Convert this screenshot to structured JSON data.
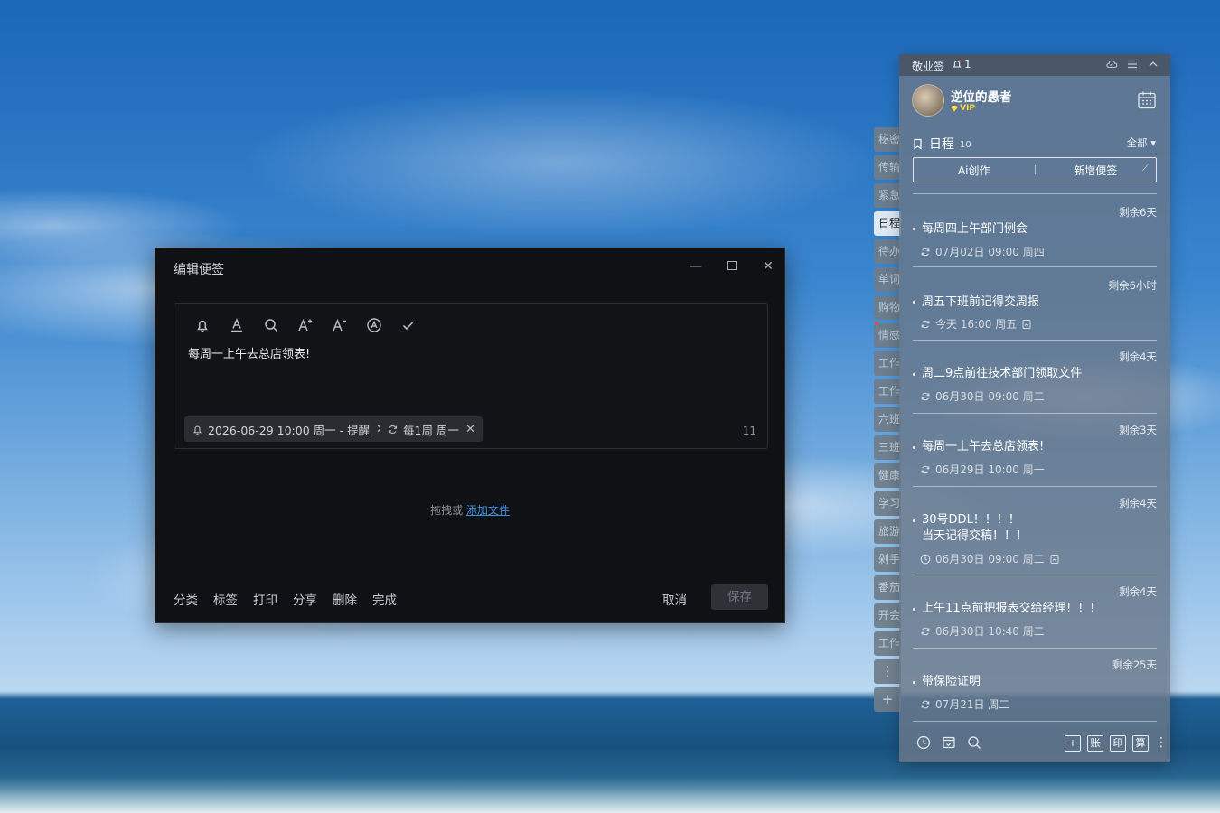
{
  "editor": {
    "title": "编辑便签",
    "note_text": "每周一上午去总店领表!",
    "reminder_chip": "2026-06-29 10:00 周一 - 提醒",
    "repeat_chip": "每1周 周一",
    "char_count": "11",
    "attach_prefix": "拖拽或",
    "attach_link": "添加文件",
    "footer": {
      "category": "分类",
      "tag": "标签",
      "print": "打印",
      "share": "分享",
      "delete": "删除",
      "complete": "完成",
      "cancel": "取消",
      "save": "保存"
    }
  },
  "side_tabs": [
    "秘密",
    "传输",
    "紧急",
    "日程",
    "待办",
    "单词",
    "购物",
    "情感",
    "工作",
    "工作",
    "六班",
    "三班",
    "健康",
    "学习",
    "旅游",
    "剁手",
    "番茄",
    "开会",
    "工作"
  ],
  "side_tab_icons": {
    "more": "⋮",
    "add": "+"
  },
  "panel": {
    "app_name": "敬业签",
    "notif_count": "1",
    "username": "逆位的愚者",
    "vip": "VIP",
    "section_title": "日程",
    "section_count": "10",
    "filter": "全部",
    "ai_button": "Ai创作",
    "new_note_button": "新增便签",
    "items": [
      {
        "remain": "剩余6天",
        "title": "每周四上午部门例会",
        "meta": "07月02日 09:00 周四"
      },
      {
        "remain": "剩余6小时",
        "title": "周五下班前记得交周报",
        "meta": "今天 16:00 周五"
      },
      {
        "remain": "剩余4天",
        "title": "周二9点前往技术部门领取文件",
        "meta": "06月30日 09:00 周二"
      },
      {
        "remain": "剩余3天",
        "title": "每周一上午去总店领表!",
        "meta": "06月29日 10:00 周一"
      },
      {
        "remain": "剩余4天",
        "title": "30号DDL！！！！",
        "title2": "当天记得交稿！！！",
        "meta": "06月30日 09:00 周二"
      },
      {
        "remain": "剩余4天",
        "title": "上午11点前把报表交给经理！！！",
        "meta": "06月30日 10:40 周二"
      },
      {
        "remain": "剩余25天",
        "title": "带保险证明",
        "meta": "07月21日 周二"
      }
    ],
    "bottom_buttons": [
      "账",
      "印",
      "算"
    ]
  }
}
